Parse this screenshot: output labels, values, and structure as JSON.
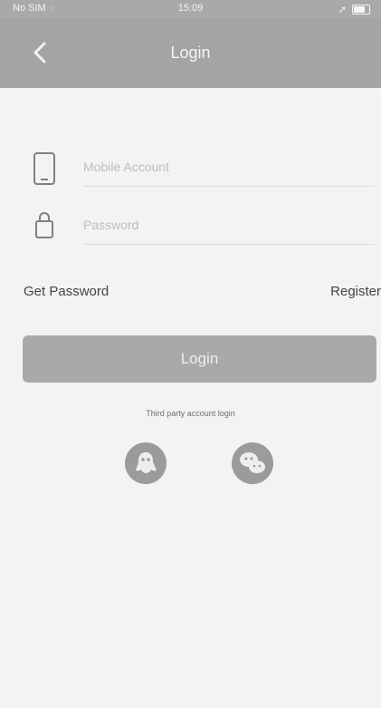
{
  "status_bar": {
    "carrier": "No SIM",
    "time": "15:09"
  },
  "header": {
    "title": "Login"
  },
  "form": {
    "account_placeholder": "Mobile Account",
    "password_placeholder": "Password"
  },
  "links": {
    "get_password": "Get Password",
    "register": "Register"
  },
  "actions": {
    "login_label": "Login"
  },
  "third_party": {
    "label": "Third party account login",
    "providers": [
      "qq",
      "wechat"
    ]
  },
  "icons": {
    "back": "chevron-left-icon",
    "phone": "mobile-phone-icon",
    "password": "lock-icon",
    "qq": "qq-icon",
    "wechat": "wechat-icon",
    "wifi": "wifi-icon",
    "battery": "battery-icon"
  },
  "colors": {
    "header_bg": "#a4a4a2",
    "button_bg": "#a9a9a7",
    "social_bg": "#9b9b99",
    "page_bg": "#f3f3f1"
  }
}
